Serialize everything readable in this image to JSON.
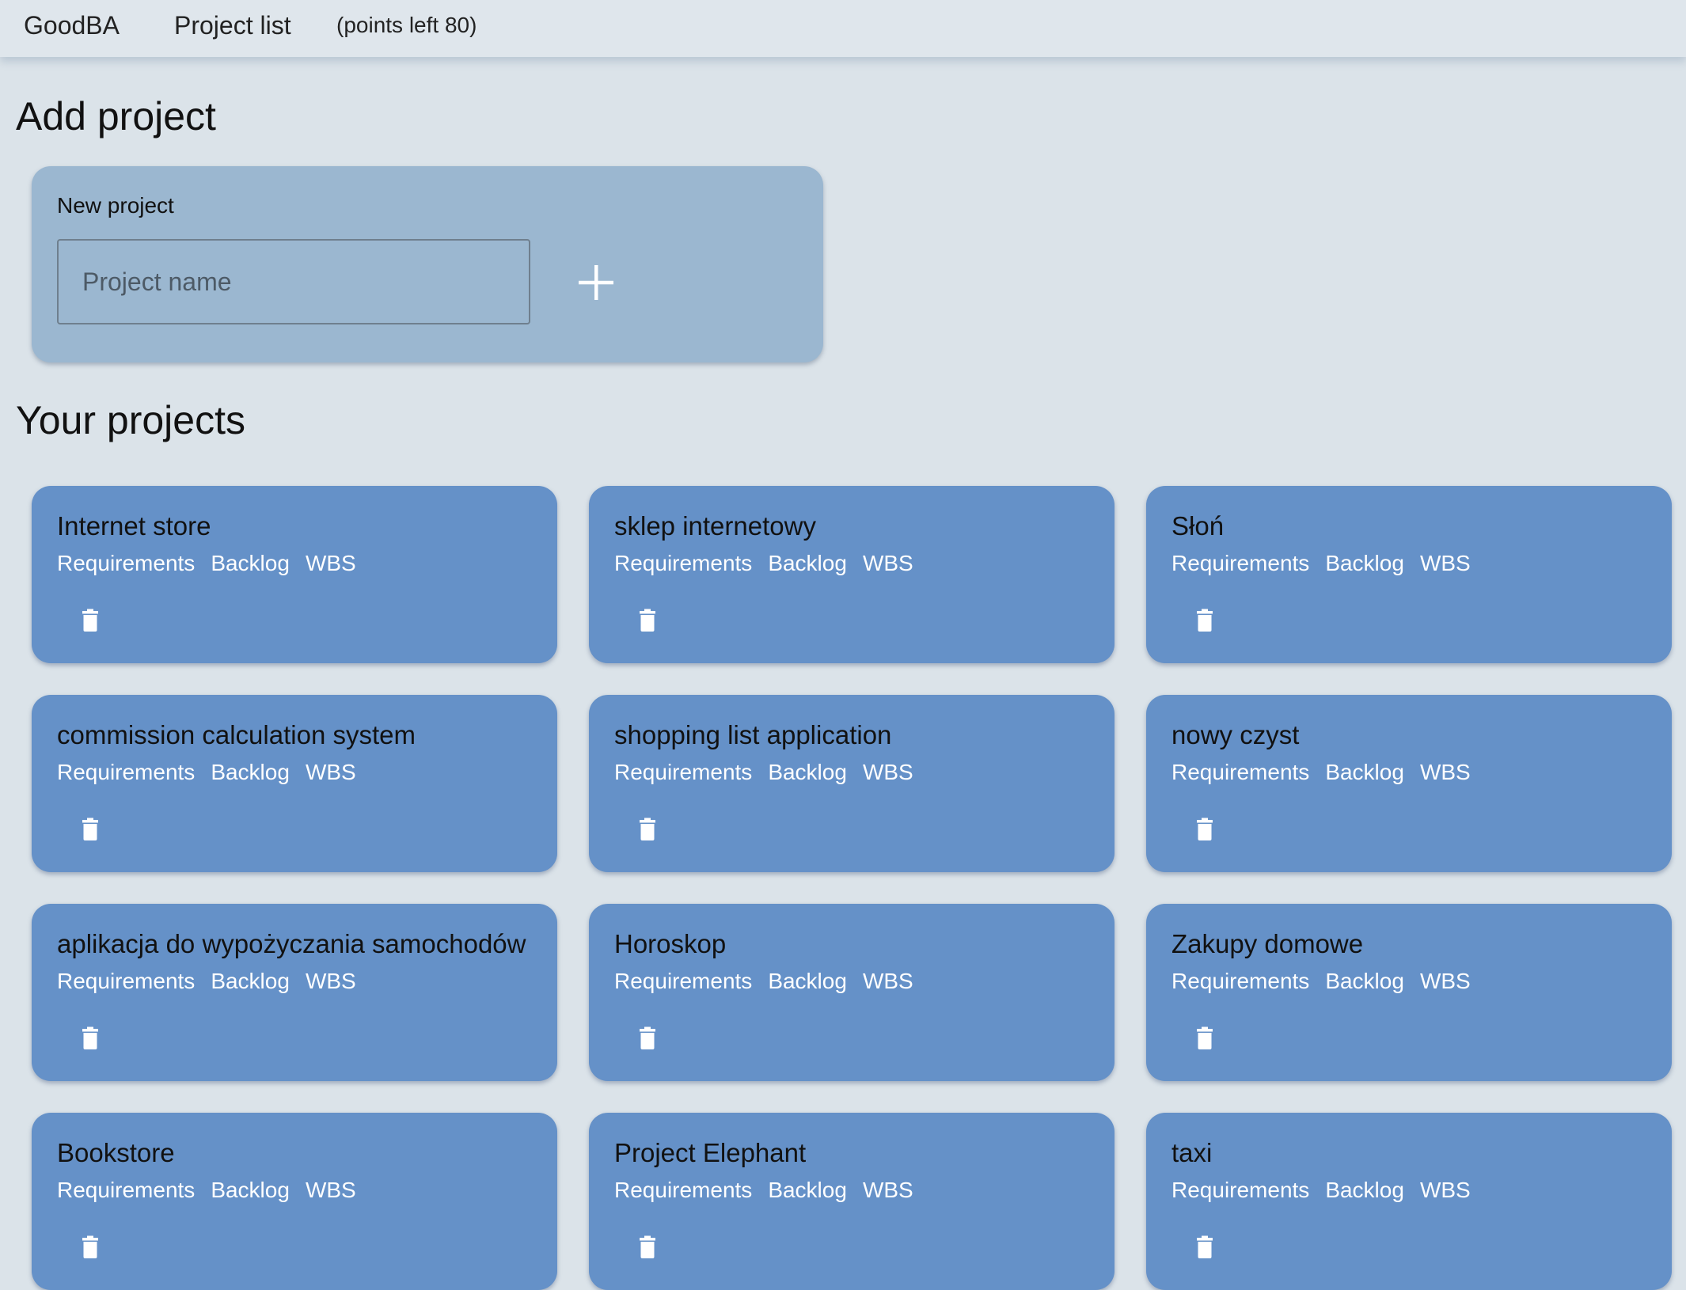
{
  "topbar": {
    "brand": "GoodBA",
    "nav_project_list": "Project list",
    "points": "(points left 80)"
  },
  "add_section": {
    "heading": "Add project",
    "card_label": "New project",
    "input_placeholder": "Project name",
    "input_value": "",
    "add_icon": "plus-icon"
  },
  "projects_section": {
    "heading": "Your projects",
    "link_labels": {
      "requirements": "Requirements",
      "backlog": "Backlog",
      "wbs": "WBS"
    },
    "delete_icon": "trash-icon",
    "projects": [
      {
        "name": "Internet store"
      },
      {
        "name": "sklep internetowy"
      },
      {
        "name": "Słoń"
      },
      {
        "name": "commission calculation system"
      },
      {
        "name": "shopping list application"
      },
      {
        "name": "nowy czyst"
      },
      {
        "name": "aplikacja do wypożyczania samochodów"
      },
      {
        "name": "Horoskop"
      },
      {
        "name": "Zakupy domowe"
      },
      {
        "name": "Bookstore"
      },
      {
        "name": "Project Elephant"
      },
      {
        "name": "taxi"
      }
    ]
  },
  "colors": {
    "background": "#dbe3e9",
    "add_card": "#9bb7d0",
    "project_card": "#6591c8",
    "link_text": "#ffffff"
  }
}
